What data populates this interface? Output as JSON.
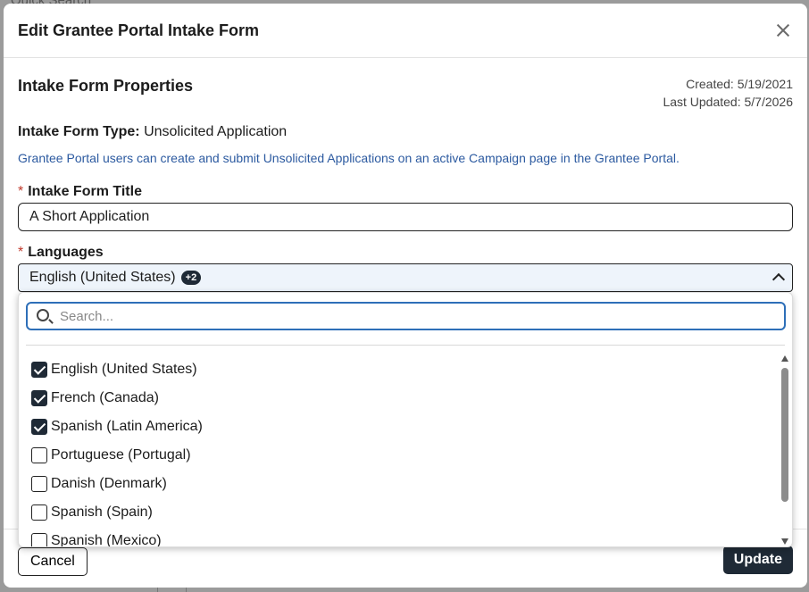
{
  "background": {
    "text": "Quick Search"
  },
  "modal": {
    "title": "Edit Grantee Portal Intake Form"
  },
  "properties": {
    "heading": "Intake Form Properties",
    "created": "Created: 5/19/2021",
    "last_updated": "Last Updated: 5/7/2026",
    "form_type_label": "Intake Form Type:",
    "form_type_value": "Unsolicited Application",
    "help_text": "Grantee Portal users can create and submit Unsolicited Applications on an active Campaign page in the Grantee Portal."
  },
  "title_field": {
    "required_mark": "*",
    "label": "Intake Form Title",
    "value": "A Short Application"
  },
  "languages_field": {
    "required_mark": "*",
    "label": "Languages",
    "selected": "English (United States)",
    "extra_count": "+2",
    "search_placeholder": "Search...",
    "options": [
      {
        "label": "English (United States)",
        "checked": true
      },
      {
        "label": "French (Canada)",
        "checked": true
      },
      {
        "label": "Spanish (Latin America)",
        "checked": true
      },
      {
        "label": "Portuguese (Portugal)",
        "checked": false
      },
      {
        "label": "Danish (Denmark)",
        "checked": false
      },
      {
        "label": "Spanish (Spain)",
        "checked": false
      },
      {
        "label": "Spanish (Mexico)",
        "checked": false
      }
    ]
  },
  "footer": {
    "cancel_label": "Cancel",
    "update_label": "Update"
  },
  "colors": {
    "primary": "#1f2a36",
    "focus": "#2e6fb8",
    "required": "#c0392b",
    "help": "#2c5aa0"
  }
}
